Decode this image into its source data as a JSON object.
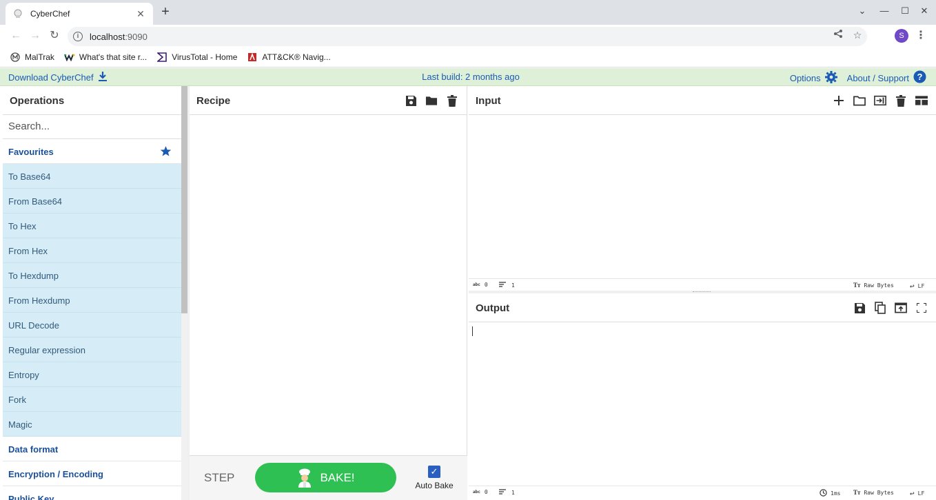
{
  "browser": {
    "tab_title": "CyberChef",
    "url_host": "localhost",
    "url_port": ":9090",
    "profile_initial": "S",
    "bookmarks": [
      {
        "label": "MalTrak",
        "icon": "maltrak-icon"
      },
      {
        "label": "What's that site r...",
        "icon": "wts-icon"
      },
      {
        "label": "VirusTotal - Home",
        "icon": "virustotal-icon"
      },
      {
        "label": "ATT&CK® Navig...",
        "icon": "attack-icon"
      }
    ]
  },
  "banner": {
    "download_label": "Download CyberChef",
    "last_build": "Last build: 2 months ago",
    "options_label": "Options",
    "about_label": "About / Support"
  },
  "operations": {
    "title": "Operations",
    "search_placeholder": "Search...",
    "favourites_label": "Favourites",
    "favourites": [
      "To Base64",
      "From Base64",
      "To Hex",
      "From Hex",
      "To Hexdump",
      "From Hexdump",
      "URL Decode",
      "Regular expression",
      "Entropy",
      "Fork",
      "Magic"
    ],
    "categories": [
      "Data format",
      "Encryption / Encoding",
      "Public Key"
    ]
  },
  "recipe": {
    "title": "Recipe",
    "step_label": "STEP",
    "bake_label": "BAKE!",
    "auto_bake_label": "Auto Bake",
    "auto_bake_checked": true
  },
  "input": {
    "title": "Input",
    "chars": "0",
    "lines": "1",
    "encoding": "Raw Bytes",
    "eol": "LF"
  },
  "output": {
    "title": "Output",
    "chars": "0",
    "lines": "1",
    "time": "1ms",
    "encoding": "Raw Bytes",
    "eol": "LF"
  },
  "colors": {
    "accent": "#1a5ab4",
    "banner_bg": "#dff0d8",
    "favourite_bg": "#d6ecf7",
    "bake_green": "#2ec052"
  }
}
